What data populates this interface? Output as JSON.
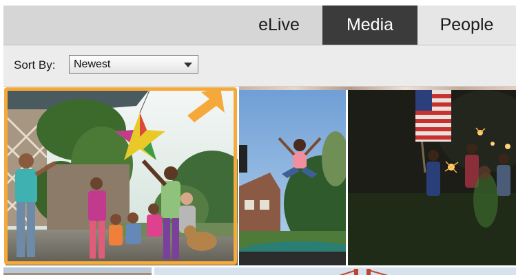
{
  "nav": {
    "tabs": [
      {
        "label": "eLive",
        "active": false
      },
      {
        "label": "Media",
        "active": true
      },
      {
        "label": "People",
        "active": false
      }
    ]
  },
  "toolbar": {
    "sort_label": "Sort By:",
    "sort_value": "Newest"
  },
  "grid": {
    "thumbnails": [
      {
        "name": "pinata-party-photo",
        "selected": true
      },
      {
        "name": "trampoline-jump-photo",
        "selected": false
      },
      {
        "name": "sparklers-flag-photo",
        "selected": false
      },
      {
        "name": "bottom-left-photo",
        "selected": false
      },
      {
        "name": "golden-gate-bridge-photo",
        "selected": false
      }
    ]
  },
  "colors": {
    "active_tab": "#3b3b3b",
    "selection_border": "#f4a93a",
    "arrow": "#f4a93a"
  }
}
